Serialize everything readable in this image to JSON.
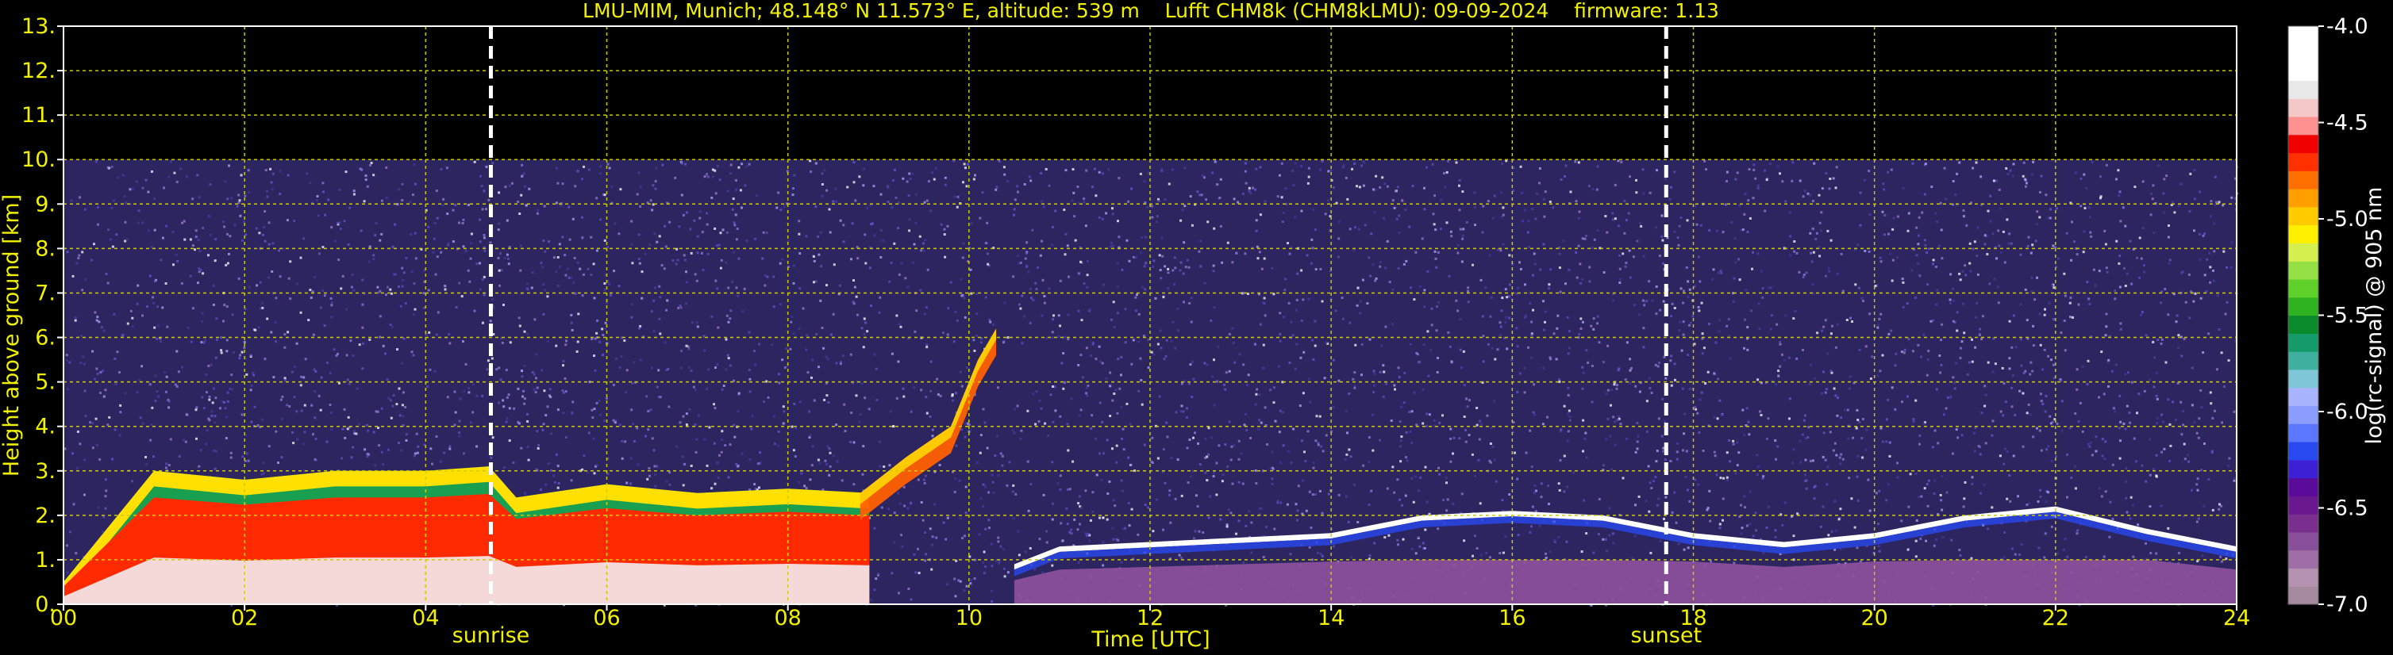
{
  "chart_data": {
    "type": "heatmap",
    "title": "LMU-MIM, Munich; 48.148° N 11.573° E, altitude: 539 m    Lufft CHM8k (CHM8kLMU): 09-09-2024    firmware: 1.13",
    "xlabel": "Time [UTC]",
    "ylabel": "Height above ground [km]",
    "xlim": [
      0,
      24
    ],
    "ylim": [
      0,
      13
    ],
    "x_ticks": [
      "00",
      "02",
      "04",
      "06",
      "08",
      "10",
      "12",
      "14",
      "16",
      "18",
      "20",
      "22",
      "24"
    ],
    "y_ticks": [
      "0.",
      "1.",
      "2.",
      "3.",
      "4.",
      "5.",
      "6.",
      "7.",
      "8.",
      "9.",
      "10.",
      "11.",
      "12.",
      "13."
    ],
    "grid": true,
    "sun_events": [
      {
        "label": "sunrise",
        "time": 4.72
      },
      {
        "label": "sunset",
        "time": 17.7
      }
    ],
    "measurement_top_km": 10,
    "colorbar": {
      "label": "log(rc-signal) @ 905 nm",
      "range": [
        -7.0,
        -4.0
      ],
      "ticks": [
        "-4.0",
        "-4.5",
        "-5.0",
        "-5.5",
        "-6.0",
        "-6.5",
        "-7.0"
      ],
      "colors": [
        "#a58aa0",
        "#b592b0",
        "#a06ea6",
        "#8a4f9a",
        "#7a2f8e",
        "#6a1890",
        "#5a0b9a",
        "#3d1fd6",
        "#2848f0",
        "#5b76ff",
        "#8b9dff",
        "#a9b4ff",
        "#7fc6d8",
        "#3fb0a0",
        "#159a6a",
        "#0a8a2a",
        "#2fb21f",
        "#5fd02a",
        "#95e045",
        "#d6f050",
        "#fff000",
        "#ffcc00",
        "#ffa000",
        "#ff7000",
        "#ff3000",
        "#f00000",
        "#ff9090",
        "#f4c8c8",
        "#e8e8e8",
        "#ffffff",
        "#ffffff",
        "#ffffff"
      ]
    },
    "features": {
      "boundary_layer_top_km": [
        {
          "time": 0.0,
          "height": 0.5
        },
        {
          "time": 1.0,
          "height": 3.0
        },
        {
          "time": 2.0,
          "height": 2.8
        },
        {
          "time": 3.0,
          "height": 3.0
        },
        {
          "time": 4.0,
          "height": 3.0
        },
        {
          "time": 4.7,
          "height": 3.1
        },
        {
          "time": 5.0,
          "height": 2.4
        },
        {
          "time": 6.0,
          "height": 2.7
        },
        {
          "time": 7.0,
          "height": 2.5
        },
        {
          "time": 8.0,
          "height": 2.6
        },
        {
          "time": 8.9,
          "height": 2.5
        }
      ],
      "rising_aerosol_layer_km": [
        {
          "time": 8.8,
          "height": 2.5
        },
        {
          "time": 9.3,
          "height": 3.3
        },
        {
          "time": 9.8,
          "height": 4.0
        },
        {
          "time": 10.1,
          "height": 5.5
        },
        {
          "time": 10.3,
          "height": 6.2
        }
      ],
      "cloud_base_km": [
        {
          "time": 10.5,
          "height": 0.9
        },
        {
          "time": 11.0,
          "height": 1.3
        },
        {
          "time": 12.0,
          "height": 1.4
        },
        {
          "time": 13.0,
          "height": 1.5
        },
        {
          "time": 14.0,
          "height": 1.6
        },
        {
          "time": 15.0,
          "height": 2.0
        },
        {
          "time": 16.0,
          "height": 2.1
        },
        {
          "time": 17.0,
          "height": 2.0
        },
        {
          "time": 18.0,
          "height": 1.6
        },
        {
          "time": 19.0,
          "height": 1.4
        },
        {
          "time": 20.0,
          "height": 1.6
        },
        {
          "time": 21.0,
          "height": 2.0
        },
        {
          "time": 22.0,
          "height": 2.2
        },
        {
          "time": 23.0,
          "height": 1.7
        },
        {
          "time": 24.0,
          "height": 1.3
        }
      ]
    }
  }
}
